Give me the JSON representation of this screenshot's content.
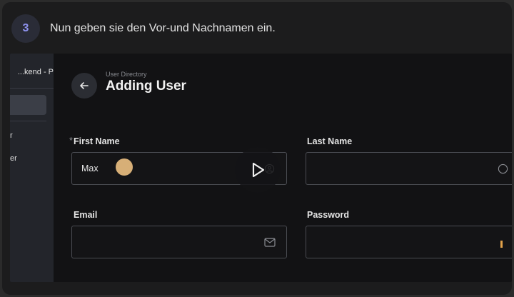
{
  "step": {
    "number": "3",
    "text": "Nun geben sie den Vor-und Nachnamen ein."
  },
  "sidebar": {
    "title": "kend - P...",
    "items": [
      {
        "label": "r"
      },
      {
        "label": "er"
      }
    ]
  },
  "header": {
    "breadcrumb": "User Directory",
    "title": "Adding User"
  },
  "form": {
    "first_name": {
      "label": "First Name",
      "required_marker": "*",
      "value": "Max"
    },
    "last_name": {
      "label": "Last Name",
      "value": ""
    },
    "email": {
      "label": "Email",
      "value": ""
    },
    "password": {
      "label": "Password",
      "value": ""
    }
  },
  "icons": {
    "back": "arrow-left-icon",
    "user": "user-circle-icon",
    "mail": "mail-icon",
    "play": "play-icon"
  },
  "colors": {
    "accent": "#8f93f0",
    "cursor": "#e2b77c"
  }
}
